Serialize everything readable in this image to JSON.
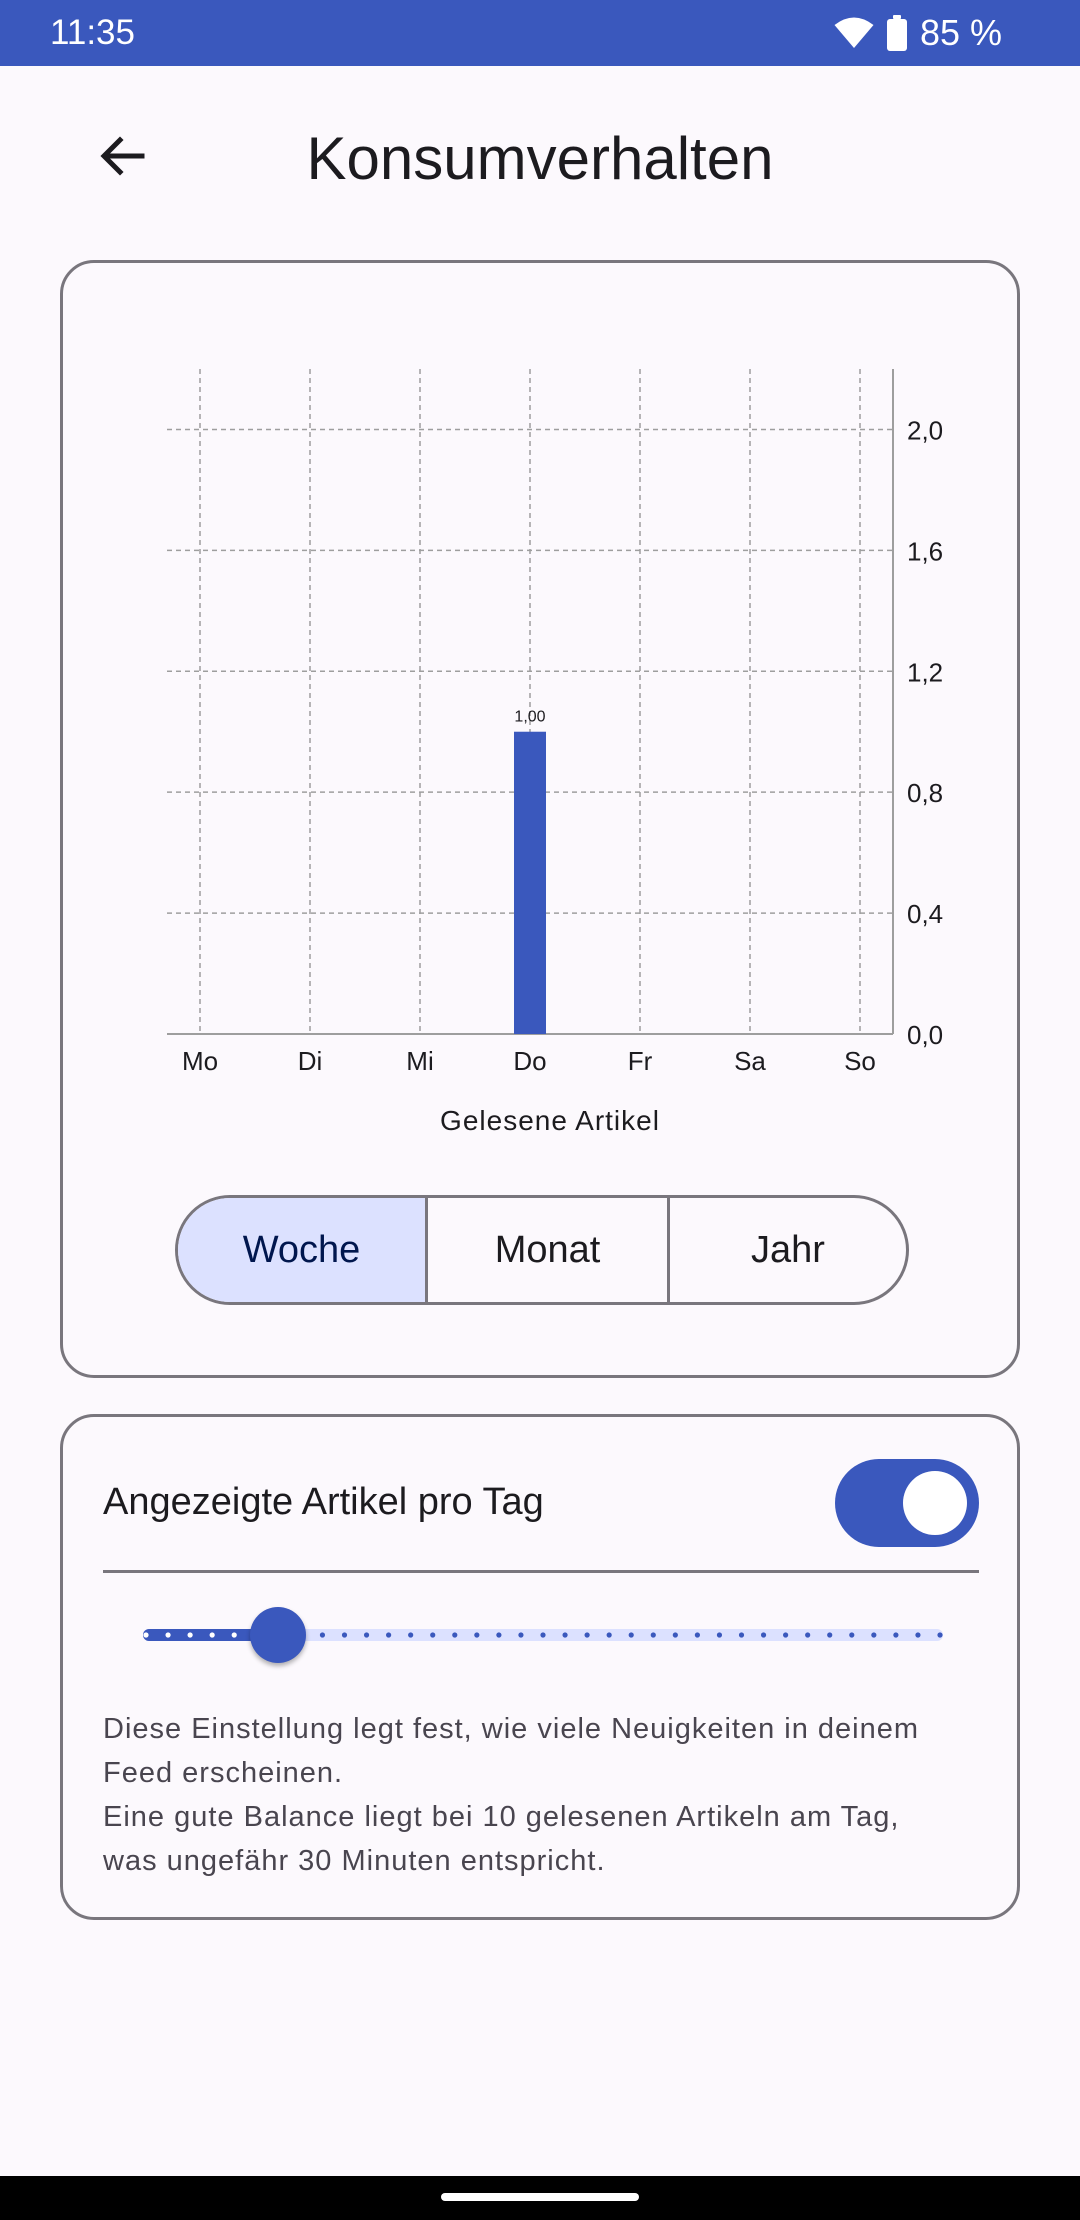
{
  "status_bar": {
    "time": "11:35",
    "battery_percent": "85 %",
    "icons": [
      "wifi-icon",
      "battery-icon"
    ]
  },
  "app_bar": {
    "title": "Konsumverhalten",
    "back_icon": "arrow-back-icon"
  },
  "chart_data": {
    "type": "bar",
    "categories": [
      "Mo",
      "Di",
      "Mi",
      "Do",
      "Fr",
      "Sa",
      "So"
    ],
    "values": [
      0,
      0,
      0,
      1.0,
      0,
      0,
      0
    ],
    "value_labels": [
      "",
      "",
      "",
      "1,00",
      "",
      "",
      ""
    ],
    "xlabel": "Gelesene Artikel",
    "ylabel": "",
    "ylim": [
      0,
      2.2
    ],
    "yticks": [
      0,
      0.4,
      0.8,
      1.2,
      1.6,
      2.0
    ],
    "ytick_labels": [
      "0,0",
      "0,4",
      "0,8",
      "1,2",
      "1,6",
      "2,0"
    ],
    "y_axis_side": "right",
    "grid": true,
    "bar_color": "#3a58bd"
  },
  "period_selector": {
    "options": [
      "Woche",
      "Monat",
      "Jahr"
    ],
    "selected": "Woche"
  },
  "settings": {
    "articles_per_day_label": "Angezeigte Artikel pro Tag",
    "toggle_on": true,
    "slider_steps": 36,
    "slider_value_step": 6,
    "description_lines": [
      "Diese Einstellung legt fest, wie viele Neuigkeiten in deinem",
      "Feed erscheinen.",
      "Eine gute Balance liegt bei 10 gelesenen Artikeln am Tag,",
      "was ungefähr 30 Minuten entspricht."
    ]
  },
  "colors": {
    "primary": "#3a58bd",
    "selected_segment": "#dce1ff",
    "outline": "#79767d",
    "background": "#fcf9fd"
  }
}
